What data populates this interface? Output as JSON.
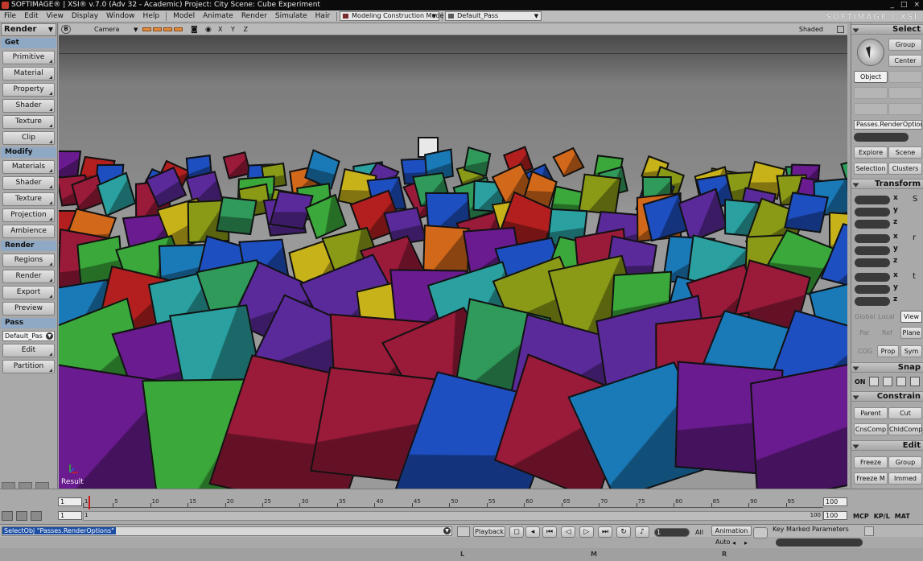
{
  "window": {
    "title": "SOFTIMAGE® | XSI® v.7.0 (Adv 32 - Academic) Project: City     Scene: Cube Experiment",
    "brand": "SOFTIMAGE | XSI"
  },
  "menubar": {
    "items": [
      "File",
      "Edit",
      "View",
      "Display",
      "Window",
      "Help",
      "Model",
      "Animate",
      "Render",
      "Simulate",
      "Hair"
    ],
    "construction_mode": "Modeling Construction Mode",
    "pass": "Default_Pass"
  },
  "left_panel": {
    "mode": "Render",
    "sections": [
      {
        "title": "Get",
        "buttons": [
          "Primitive",
          "Material",
          "Property",
          "Shader",
          "Texture",
          "Clip"
        ]
      },
      {
        "title": "Modify",
        "buttons": [
          "Materials",
          "Shader",
          "Texture",
          "Projection",
          "Ambience"
        ]
      },
      {
        "title": "Render",
        "buttons": [
          "Regions",
          "Render",
          "Export",
          "Preview"
        ]
      },
      {
        "title": "Pass",
        "buttons": [
          "Edit",
          "Partition"
        ]
      }
    ],
    "pass_field": "Default_Pas"
  },
  "viewport": {
    "b_label": "B",
    "camera": "Camera",
    "xyz": "X Y Z",
    "shading": "Shaded",
    "label": "Result"
  },
  "right_panel": {
    "select_title": "Select",
    "group": "Group",
    "center": "Center",
    "object": "Object",
    "pass_field": "Passes.RenderOptions",
    "explore": "Explore",
    "scene": "Scene",
    "selection": "Selection",
    "clusters": "Clusters",
    "transform_title": "Transform",
    "axes": [
      "x",
      "y",
      "z"
    ],
    "global": "Global",
    "local": "Local",
    "view": "View",
    "par": "Par",
    "ref": "Ref",
    "plane": "Plane",
    "cog": "COG",
    "prop": "Prop",
    "sym": "Sym",
    "snap_title": "Snap",
    "snap_on": "ON",
    "constrain_title": "Constrain",
    "parent": "Parent",
    "cut": "Cut",
    "cnscomp": "CnsComp",
    "chldcomp": "ChldComp",
    "edit_title": "Edit",
    "freeze": "Freeze",
    "group2": "Group",
    "freeze_m": "Freeze M",
    "immed": "Immed"
  },
  "timeline": {
    "start": "1",
    "start2": "1",
    "end": "100",
    "end2": "100",
    "end_mark": "100",
    "ticks": [
      "1",
      "5",
      "10",
      "15",
      "20",
      "25",
      "30",
      "35",
      "40",
      "45",
      "50",
      "55",
      "60",
      "65",
      "70",
      "75",
      "80",
      "85",
      "90",
      "95"
    ],
    "tabs": [
      "MCP",
      "KP/L",
      "MAT"
    ]
  },
  "commandbar": {
    "command": "SelectObj \"Passes.RenderOptions\"",
    "playback": "Playback",
    "frame": "1",
    "all": "All",
    "animation": "Animation",
    "auto": "Auto",
    "key_marked": "Key Marked Parameters"
  },
  "bottom_letters": [
    "L",
    "M",
    "R"
  ],
  "colors": {
    "accent": "#1c4fa3",
    "section": "#8fa8c4"
  }
}
